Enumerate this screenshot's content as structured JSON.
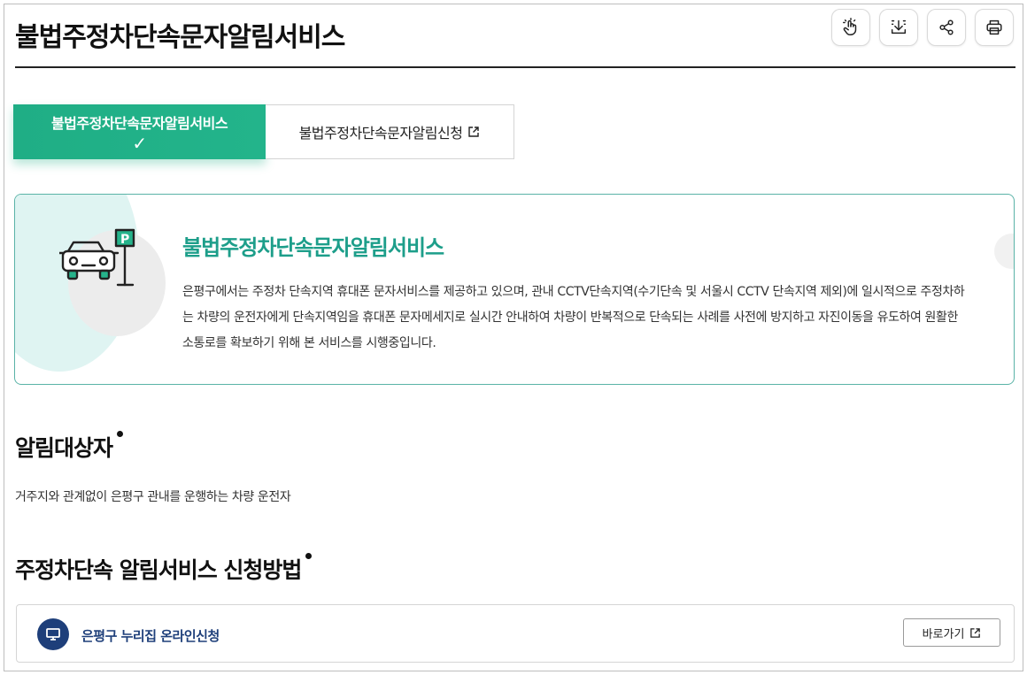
{
  "header": {
    "title": "불법주정차단속문자알림서비스",
    "tools": [
      {
        "icon": "hand-pointer-icon",
        "name": "accessibility-button"
      },
      {
        "icon": "download-icon",
        "name": "download-button"
      },
      {
        "icon": "share-icon",
        "name": "share-button"
      },
      {
        "icon": "print-icon",
        "name": "print-button"
      }
    ]
  },
  "tabs": {
    "active_label": "불법주정차단속문자알림서비스",
    "active_check": "✓",
    "link_label": "불법주정차단속문자알림신청"
  },
  "intro": {
    "heading": "불법주정차단속문자알림서비스",
    "body": "은평구에서는 주정차 단속지역 휴대폰 문자서비스를 제공하고 있으며, 관내 CCTV단속지역(수기단속 및 서울시 CCTV 단속지역 제외)에 일시적으로 주정차하는 차량의 운전자에게 단속지역임을 휴대폰 문자메세지로 실시간 안내하여 차량이 반복적으로 단속되는 사례를 사전에 방지하고 자진이동을 유도하여 원활한 소통로를 확보하기 위해 본 서비스를 시행중입니다."
  },
  "target_section": {
    "title": "알림대상자",
    "body": "거주지와 관계없이 은평구 관내를 운행하는 차량 운전자"
  },
  "apply_section": {
    "title": "주정차단속 알림서비스 신청방법",
    "row_label": "은평구 누리집 온라인신청",
    "go_label": "바로가기"
  },
  "colors": {
    "accent_green": "#1fae85",
    "heading_teal": "#1d9e8a",
    "navy": "#1e3f7a"
  }
}
